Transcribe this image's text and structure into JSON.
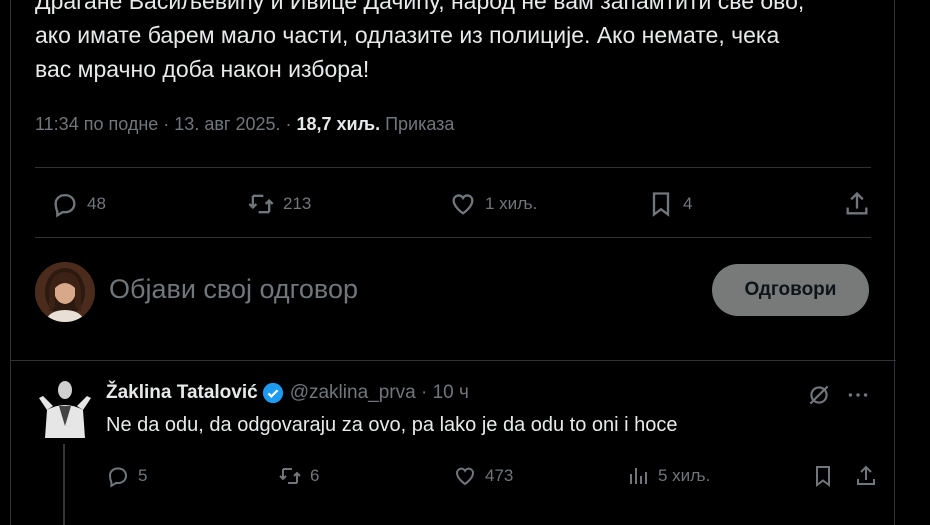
{
  "tweet": {
    "text_lines": [
      "Драгане Васиљевићу и Ивице Дачићу, народ не вам запамтити све ово,",
      "ако имате барем мало части, одлазите из полиције. Ако немате, чека",
      "вас мрачно доба након избора!"
    ],
    "time": "11:34 по подне",
    "date": "13. авг 2025.",
    "views_count": "18,7 хиљ.",
    "views_label": "Приказа"
  },
  "actions": {
    "replies": "48",
    "reposts": "213",
    "likes": "1 хиљ.",
    "bookmarks": "4"
  },
  "composer": {
    "placeholder": "Објави свој одговор",
    "button_label": "Одговори"
  },
  "reply": {
    "name": "Žaklina Tatalović",
    "handle": "@zaklina_prva",
    "time": "10 ч",
    "text": "Ne da odu, da odgovaraju za ovo, pa lako je da odu to oni i hoce",
    "replies": "5",
    "reposts": "6",
    "likes": "473",
    "views": "5 хиљ."
  },
  "colors": {
    "background": "#000000",
    "text": "#e7e9ea",
    "muted": "#71767b",
    "border": "#2f3336",
    "verified": "#1d9bf0",
    "reply_button_bg": "#787a7a"
  }
}
